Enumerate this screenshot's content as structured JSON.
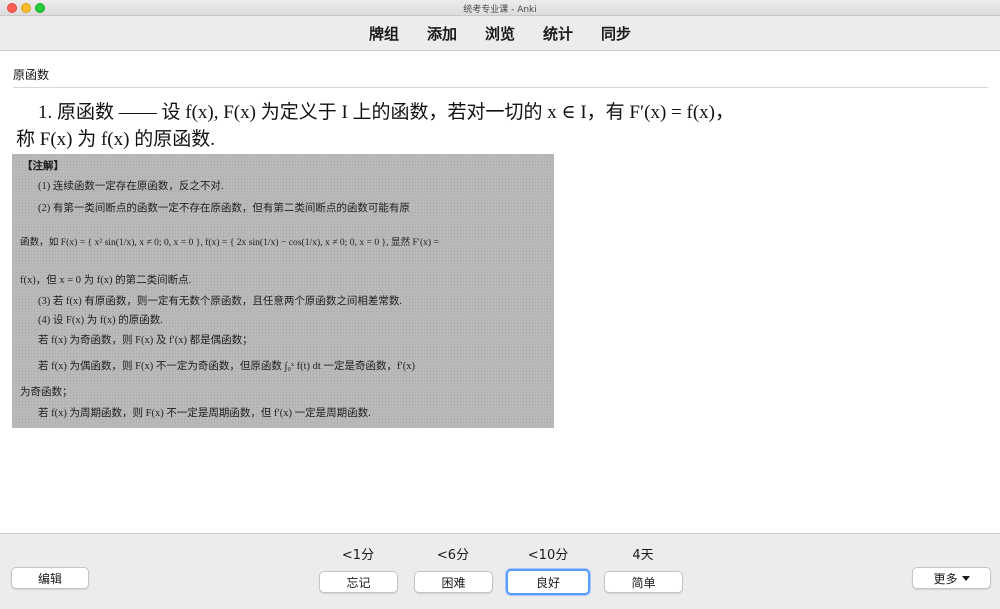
{
  "window": {
    "title": "统考专业课 - Anki"
  },
  "toolbar": {
    "items": [
      "牌组",
      "添加",
      "浏览",
      "统计",
      "同步"
    ]
  },
  "card": {
    "deck_title": "原函数",
    "definition": {
      "line1": "1. 原函数 —— 设 f(x), F(x) 为定义于 I 上的函数，若对一切的 x ∈ I，有 F′(x) = f(x)，",
      "line2": "称 F(x) 为 f(x) 的原函数."
    },
    "notes": {
      "heading": "【注解】",
      "lines": [
        "(1) 连续函数一定存在原函数，反之不对.",
        "(2) 有第一类间断点的函数一定不存在原函数，但有第二类间断点的函数可能有原",
        "函数，如 F(x) = { x² sin(1/x), x ≠ 0;  0, x = 0 },  f(x) = { 2x sin(1/x) − cos(1/x), x ≠ 0;  0, x = 0 },  显然 F′(x) =",
        "f(x)，但 x = 0 为 f(x) 的第二类间断点.",
        "(3) 若 f(x) 有原函数，则一定有无数个原函数，且任意两个原函数之间相差常数.",
        "(4) 设 F(x) 为 f(x) 的原函数.",
        "若 f(x) 为奇函数，则 F(x) 及 f′(x) 都是偶函数；",
        "若 f(x) 为偶函数，则 F(x) 不一定为奇函数，但原函数 ∫₀ˣ f(t) dt 一定是奇函数，f′(x)",
        "为奇函数；",
        "若 f(x) 为周期函数，则 F(x) 不一定是周期函数，但 f′(x) 一定是周期函数."
      ]
    }
  },
  "bottom": {
    "edit_label": "编辑",
    "more_label": "更多",
    "answers": [
      {
        "interval": "<1分",
        "label": "忘记"
      },
      {
        "interval": "<6分",
        "label": "困难"
      },
      {
        "interval": "<10分",
        "label": "良好"
      },
      {
        "interval": "4天",
        "label": "简单"
      }
    ]
  },
  "colors": {
    "focus_ring": "#5b9dff",
    "toolbar_bg": "#ececec"
  }
}
